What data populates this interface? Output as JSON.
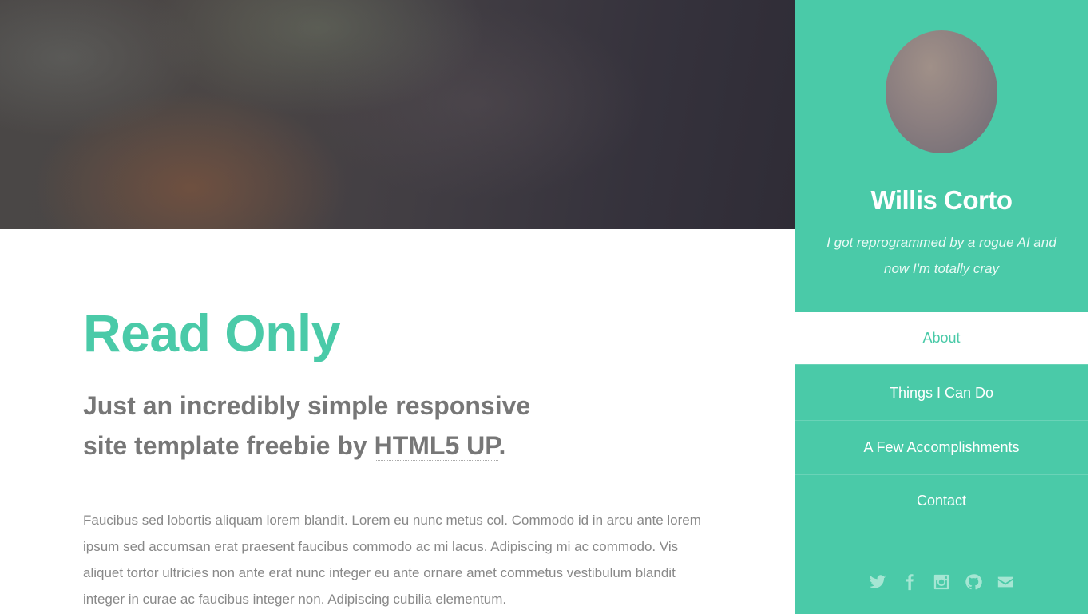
{
  "main": {
    "title": "Read Only",
    "subtitle_prefix": "Just an incredibly simple responsive site template freebie by ",
    "subtitle_link": "HTML5 UP",
    "subtitle_suffix": ".",
    "body": "Faucibus sed lobortis aliquam lorem blandit. Lorem eu nunc metus col. Commodo id in arcu ante lorem ipsum sed accumsan erat praesent faucibus commodo ac mi lacus. Adipiscing mi ac commodo. Vis aliquet tortor ultricies non ante erat nunc integer eu ante ornare amet commetus vestibulum blandit integer in curae ac faucibus integer non. Adipiscing cubilia elementum."
  },
  "sidebar": {
    "name": "Willis Corto",
    "tagline": "I got reprogrammed by a rogue AI and now I'm totally cray",
    "nav": [
      {
        "label": "About",
        "active": true
      },
      {
        "label": "Things I Can Do",
        "active": false
      },
      {
        "label": "A Few Accomplishments",
        "active": false
      },
      {
        "label": "Contact",
        "active": false
      }
    ],
    "socials": [
      "twitter-icon",
      "facebook-icon",
      "instagram-icon",
      "github-icon",
      "envelope-icon"
    ]
  },
  "colors": {
    "accent": "#4acaa8",
    "text_gray": "#777777",
    "body_gray": "#888888"
  }
}
